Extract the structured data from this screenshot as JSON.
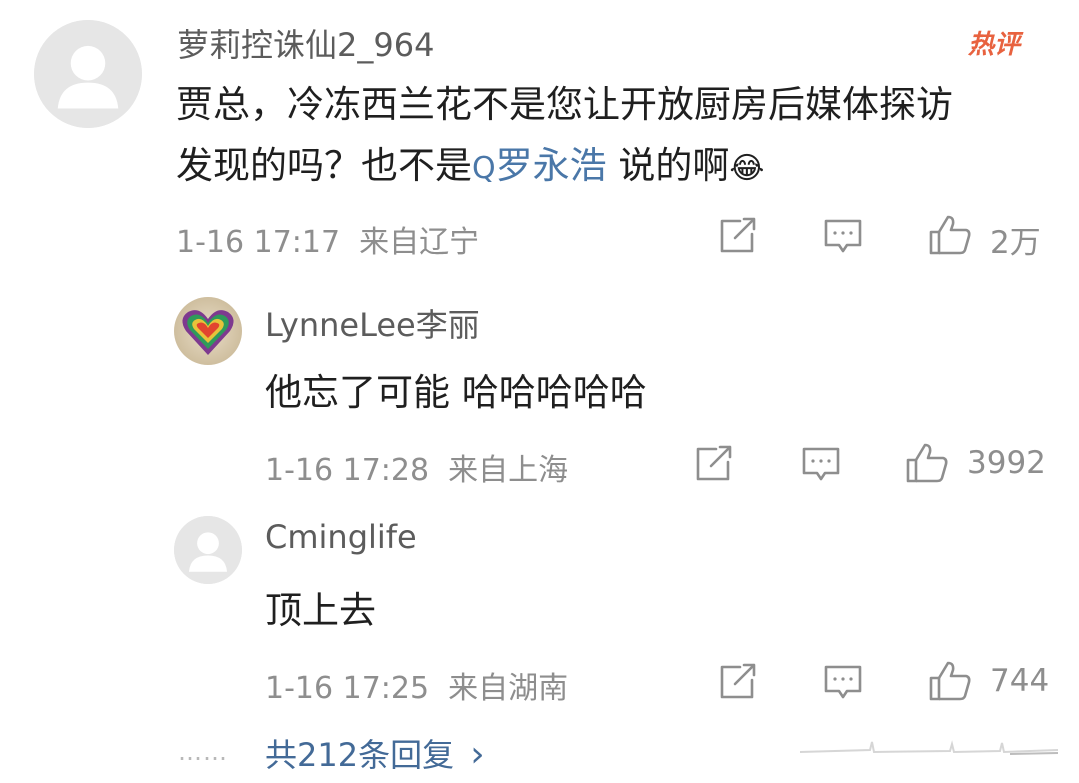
{
  "main_comment": {
    "username": "萝莉控诛仙2_964",
    "badge": "热评",
    "text_line1": "贾总，冷冻西兰花不是您让开放厨房后媒体探访",
    "text_line2_prefix": "发现的吗？也不是",
    "mention_icon": "Q",
    "mention_name": "罗永浩",
    "text_line2_suffix": " 说的啊",
    "emoji": "😂",
    "timestamp": "1-16 17:17",
    "location": "来自辽宁",
    "likes": "2万"
  },
  "replies": [
    {
      "username": "LynneLee李丽",
      "text": "他忘了可能 哈哈哈哈哈",
      "timestamp": "1-16 17:28",
      "location": "来自上海",
      "likes": "3992"
    },
    {
      "username": "Cminglife",
      "text": "顶上去",
      "timestamp": "1-16 17:25",
      "location": "来自湖南",
      "likes": "744"
    }
  ],
  "footer": {
    "dots": "……",
    "more_replies": "共212条回复",
    "chevron": "›"
  }
}
